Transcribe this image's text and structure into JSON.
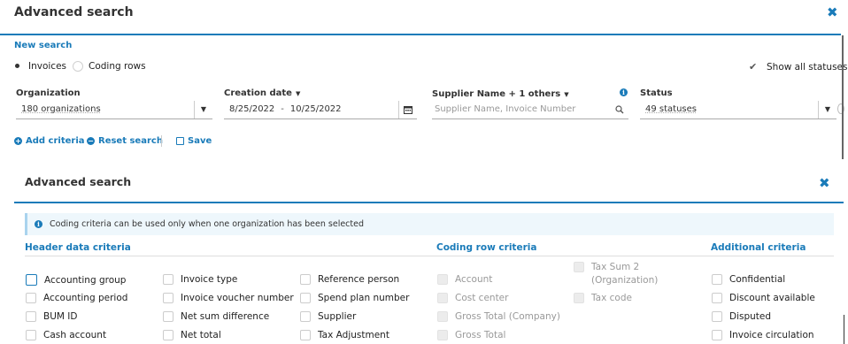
{
  "top": {
    "title": "Advanced search",
    "new_search": "New search",
    "radios": [
      {
        "label": "Invoices",
        "selected": true
      },
      {
        "label": "Coding rows",
        "selected": false
      }
    ],
    "show_all_statuses": "Show all statuses",
    "fields": {
      "organization": {
        "label": "Organization",
        "value": "180 organizations"
      },
      "creation_date": {
        "label": "Creation date",
        "from": "8/25/2022",
        "dash": "-",
        "to": "10/25/2022"
      },
      "supplier": {
        "label": "Supplier Name + 1 others",
        "placeholder": "Supplier Name, Invoice Number"
      },
      "status": {
        "label": "Status",
        "value": "49 statuses"
      }
    },
    "actions": {
      "add": "Add criteria",
      "reset": "Reset search",
      "save": "Save"
    }
  },
  "panel": {
    "title": "Advanced search",
    "info": "Coding criteria can be used only when one organization has been selected",
    "sections": {
      "header": "Header data criteria",
      "coding": "Coding row criteria",
      "additional": "Additional criteria"
    },
    "header_col1": [
      "Accounting group",
      "Accounting period",
      "BUM ID",
      "Cash account"
    ],
    "header_col2": [
      "Invoice type",
      "Invoice voucher number",
      "Net sum difference",
      "Net total"
    ],
    "header_col3": [
      "Reference person",
      "Spend plan number",
      "Supplier",
      "Tax Adjustment"
    ],
    "coding_col1": [
      "Account",
      "Cost center",
      "Gross Total (Company)",
      "Gross Total"
    ],
    "coding_col2_top_line1": "Tax Sum 2",
    "coding_col2_top_line2": "(Organization)",
    "coding_col2": [
      "Tax code"
    ],
    "additional": [
      "Confidential",
      "Discount available",
      "Disputed",
      "Invoice circulation"
    ]
  },
  "icons": {
    "close": "close-icon",
    "calendar": "calendar-icon",
    "search": "search-icon",
    "info": "info-icon",
    "check": "check-icon",
    "plus": "plus-circle-icon",
    "minus": "minus-circle-icon",
    "save": "save-icon"
  },
  "colors": {
    "accent": "#1a7bb9",
    "info_bg": "#eef7fc"
  }
}
